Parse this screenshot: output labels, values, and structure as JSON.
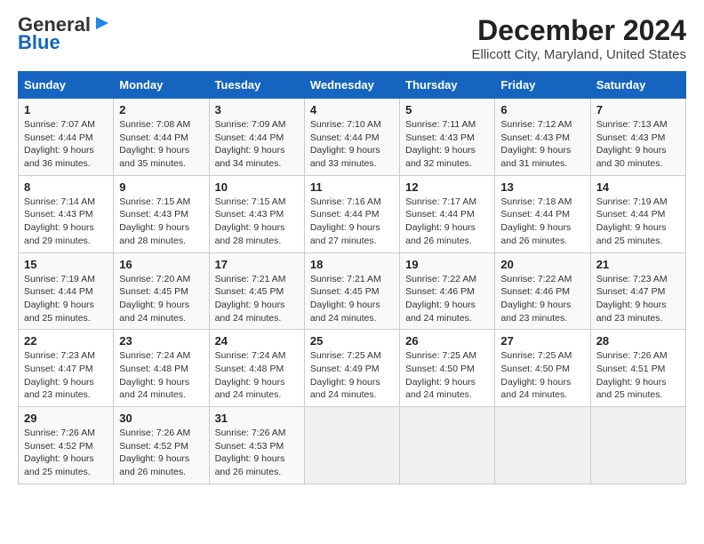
{
  "header": {
    "logo_line1": "General",
    "logo_line2": "Blue",
    "title": "December 2024",
    "subtitle": "Ellicott City, Maryland, United States"
  },
  "weekdays": [
    "Sunday",
    "Monday",
    "Tuesday",
    "Wednesday",
    "Thursday",
    "Friday",
    "Saturday"
  ],
  "weeks": [
    [
      {
        "day": "1",
        "info": "Sunrise: 7:07 AM\nSunset: 4:44 PM\nDaylight: 9 hours\nand 36 minutes."
      },
      {
        "day": "2",
        "info": "Sunrise: 7:08 AM\nSunset: 4:44 PM\nDaylight: 9 hours\nand 35 minutes."
      },
      {
        "day": "3",
        "info": "Sunrise: 7:09 AM\nSunset: 4:44 PM\nDaylight: 9 hours\nand 34 minutes."
      },
      {
        "day": "4",
        "info": "Sunrise: 7:10 AM\nSunset: 4:44 PM\nDaylight: 9 hours\nand 33 minutes."
      },
      {
        "day": "5",
        "info": "Sunrise: 7:11 AM\nSunset: 4:43 PM\nDaylight: 9 hours\nand 32 minutes."
      },
      {
        "day": "6",
        "info": "Sunrise: 7:12 AM\nSunset: 4:43 PM\nDaylight: 9 hours\nand 31 minutes."
      },
      {
        "day": "7",
        "info": "Sunrise: 7:13 AM\nSunset: 4:43 PM\nDaylight: 9 hours\nand 30 minutes."
      }
    ],
    [
      {
        "day": "8",
        "info": "Sunrise: 7:14 AM\nSunset: 4:43 PM\nDaylight: 9 hours\nand 29 minutes."
      },
      {
        "day": "9",
        "info": "Sunrise: 7:15 AM\nSunset: 4:43 PM\nDaylight: 9 hours\nand 28 minutes."
      },
      {
        "day": "10",
        "info": "Sunrise: 7:15 AM\nSunset: 4:43 PM\nDaylight: 9 hours\nand 28 minutes."
      },
      {
        "day": "11",
        "info": "Sunrise: 7:16 AM\nSunset: 4:44 PM\nDaylight: 9 hours\nand 27 minutes."
      },
      {
        "day": "12",
        "info": "Sunrise: 7:17 AM\nSunset: 4:44 PM\nDaylight: 9 hours\nand 26 minutes."
      },
      {
        "day": "13",
        "info": "Sunrise: 7:18 AM\nSunset: 4:44 PM\nDaylight: 9 hours\nand 26 minutes."
      },
      {
        "day": "14",
        "info": "Sunrise: 7:19 AM\nSunset: 4:44 PM\nDaylight: 9 hours\nand 25 minutes."
      }
    ],
    [
      {
        "day": "15",
        "info": "Sunrise: 7:19 AM\nSunset: 4:44 PM\nDaylight: 9 hours\nand 25 minutes."
      },
      {
        "day": "16",
        "info": "Sunrise: 7:20 AM\nSunset: 4:45 PM\nDaylight: 9 hours\nand 24 minutes."
      },
      {
        "day": "17",
        "info": "Sunrise: 7:21 AM\nSunset: 4:45 PM\nDaylight: 9 hours\nand 24 minutes."
      },
      {
        "day": "18",
        "info": "Sunrise: 7:21 AM\nSunset: 4:45 PM\nDaylight: 9 hours\nand 24 minutes."
      },
      {
        "day": "19",
        "info": "Sunrise: 7:22 AM\nSunset: 4:46 PM\nDaylight: 9 hours\nand 24 minutes."
      },
      {
        "day": "20",
        "info": "Sunrise: 7:22 AM\nSunset: 4:46 PM\nDaylight: 9 hours\nand 23 minutes."
      },
      {
        "day": "21",
        "info": "Sunrise: 7:23 AM\nSunset: 4:47 PM\nDaylight: 9 hours\nand 23 minutes."
      }
    ],
    [
      {
        "day": "22",
        "info": "Sunrise: 7:23 AM\nSunset: 4:47 PM\nDaylight: 9 hours\nand 23 minutes."
      },
      {
        "day": "23",
        "info": "Sunrise: 7:24 AM\nSunset: 4:48 PM\nDaylight: 9 hours\nand 24 minutes."
      },
      {
        "day": "24",
        "info": "Sunrise: 7:24 AM\nSunset: 4:48 PM\nDaylight: 9 hours\nand 24 minutes."
      },
      {
        "day": "25",
        "info": "Sunrise: 7:25 AM\nSunset: 4:49 PM\nDaylight: 9 hours\nand 24 minutes."
      },
      {
        "day": "26",
        "info": "Sunrise: 7:25 AM\nSunset: 4:50 PM\nDaylight: 9 hours\nand 24 minutes."
      },
      {
        "day": "27",
        "info": "Sunrise: 7:25 AM\nSunset: 4:50 PM\nDaylight: 9 hours\nand 24 minutes."
      },
      {
        "day": "28",
        "info": "Sunrise: 7:26 AM\nSunset: 4:51 PM\nDaylight: 9 hours\nand 25 minutes."
      }
    ],
    [
      {
        "day": "29",
        "info": "Sunrise: 7:26 AM\nSunset: 4:52 PM\nDaylight: 9 hours\nand 25 minutes."
      },
      {
        "day": "30",
        "info": "Sunrise: 7:26 AM\nSunset: 4:52 PM\nDaylight: 9 hours\nand 26 minutes."
      },
      {
        "day": "31",
        "info": "Sunrise: 7:26 AM\nSunset: 4:53 PM\nDaylight: 9 hours\nand 26 minutes."
      },
      {
        "day": "",
        "info": ""
      },
      {
        "day": "",
        "info": ""
      },
      {
        "day": "",
        "info": ""
      },
      {
        "day": "",
        "info": ""
      }
    ]
  ]
}
